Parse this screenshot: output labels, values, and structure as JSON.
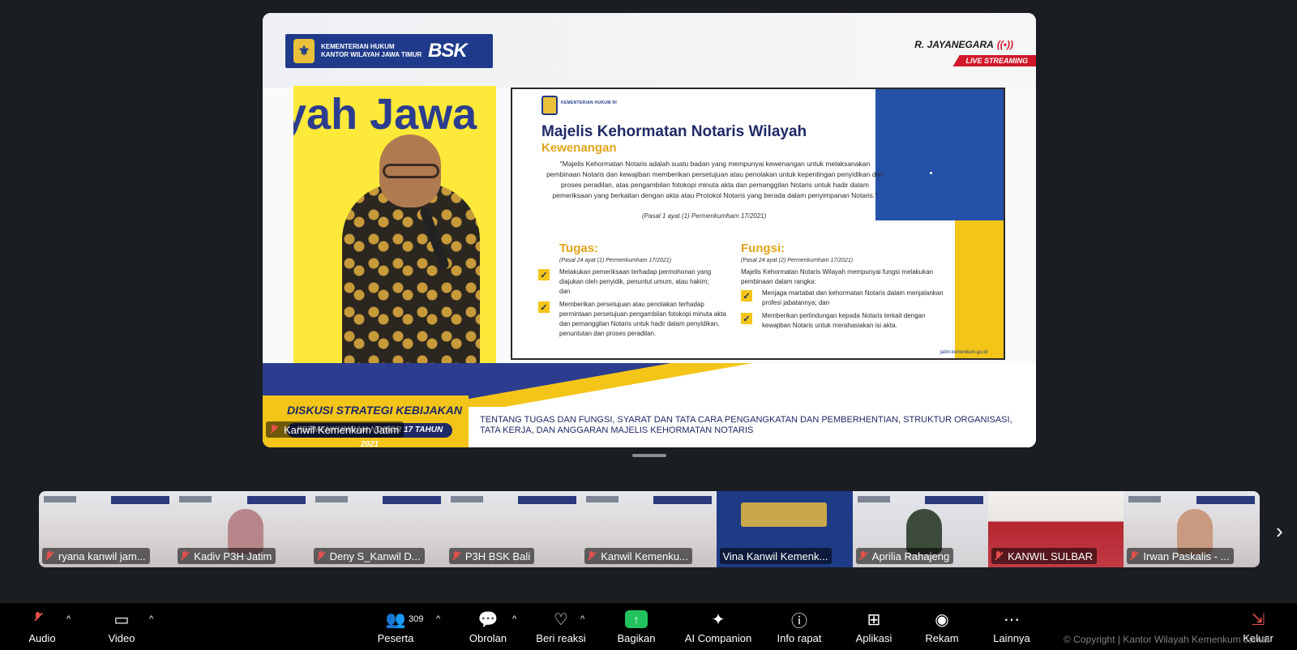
{
  "stream": {
    "org_line1": "KEMENTERIAN HUKUM",
    "org_line2": "KANTOR WILAYAH JAWA TIMUR",
    "bsk": "BSK",
    "host": "R. JAYANEGARA",
    "live": "LIVE STREAMING",
    "speaker_bg_text": "yah Jawa",
    "diskusi_title": "DISKUSI STRATEGI KEBIJAKAN",
    "diskusi_sub": "PERMENKUMHAM NOMOR 17 TAHUN 2021",
    "caption": "TENTANG TUGAS DAN FUNGSI, SYARAT DAN TATA CARA PENGANGKATAN DAN PEMBERHENTIAN, STRUKTUR ORGANISASI, TATA KERJA, DAN ANGGARAN MAJELIS KEHORMATAN NOTARIS",
    "main_participant": "Kanwil Kemenkum Jatim"
  },
  "slide": {
    "org": "KEMENTERIAN HUKUM RI",
    "title": "Majelis Kehormatan Notaris Wilayah",
    "subtitle": "Kewenangan",
    "quote": "\"Majelis Kehormatan Notaris adalah suatu badan yang mempunyai kewenangan untuk melaksanakan pembinaan Notaris dan kewajiban memberikan persetujuan atau penolakan untuk kepentingan penyidikan dan proses peradilan, atas pengambilan fotokopi minuta akta dan pemanggilan Notaris untuk hadir dalam pemeriksaan yang berkaitan dengan akta atau Protokol Notaris yang berada dalam penyimpanan Notaris.\"",
    "quote_ref": "(Pasal 1 ayat (1) Permenkumham 17/2021)",
    "tugas_title": "Tugas:",
    "tugas_ref": "(Pasal 24 ayat (1) Permenkumham 17/2021)",
    "tugas_items": [
      "Melakukan pemeriksaan terhadap permohonan yang diajukan oleh penyidik, penuntut umum, atau hakim; dan",
      "Memberikan persetujuan atau penolakan terhadap permintaan persetujuan pengambilan fotokopi minuta akta dan pemanggilan Notaris untuk hadir dalam penyidikan, penuntutan dan proses peradilan."
    ],
    "fungsi_title": "Fungsi:",
    "fungsi_ref": "(Pasal 24 ayat (2) Permenkumham 17/2021)",
    "fungsi_intro": "Majelis Kehormatan Notaris Wilayah mempunyai fungsi melakukan pembinaan dalam rangka:",
    "fungsi_items": [
      "Menjaga martabat dan kehormatan Notaris dalam menjalankan profesi jabatannya; dan",
      "Memberikan perlindungan kepada Notaris terkait dengan kewajiban Notaris untuk merahasiakan isi akta."
    ],
    "site": "jatim.kemenkum.go.id"
  },
  "gallery": [
    {
      "name": "ryana kanwil jam...",
      "muted": true
    },
    {
      "name": "Kadiv P3H Jatim",
      "muted": true
    },
    {
      "name": "Deny S_Kanwil D...",
      "muted": true
    },
    {
      "name": "P3H BSK Bali",
      "muted": true
    },
    {
      "name": "Kanwil Kemenku...",
      "muted": true
    },
    {
      "name": "Vina Kanwil Kemenk...",
      "muted": false
    },
    {
      "name": "Aprilia Rahajeng",
      "muted": true
    },
    {
      "name": "KANWIL SULBAR",
      "muted": true
    },
    {
      "name": "Irwan Paskalis - ...",
      "muted": true
    }
  ],
  "toolbar": {
    "audio": "Audio",
    "video": "Video",
    "peserta": "Peserta",
    "peserta_count": "309",
    "obrolan": "Obrolan",
    "reaksi": "Beri reaksi",
    "bagikan": "Bagikan",
    "ai": "AI Companion",
    "info": "Info rapat",
    "aplikasi": "Aplikasi",
    "rekam": "Rekam",
    "lainnya": "Lainnya",
    "keluar": "Keluar"
  },
  "copyright": "© Copyright | Kantor Wilayah Kemenkum Jambi",
  "colors": {
    "accent_green": "#22c35e",
    "muted_red": "#e5514b",
    "brand_blue": "#1f3a8a",
    "brand_yellow": "#f3c518"
  }
}
